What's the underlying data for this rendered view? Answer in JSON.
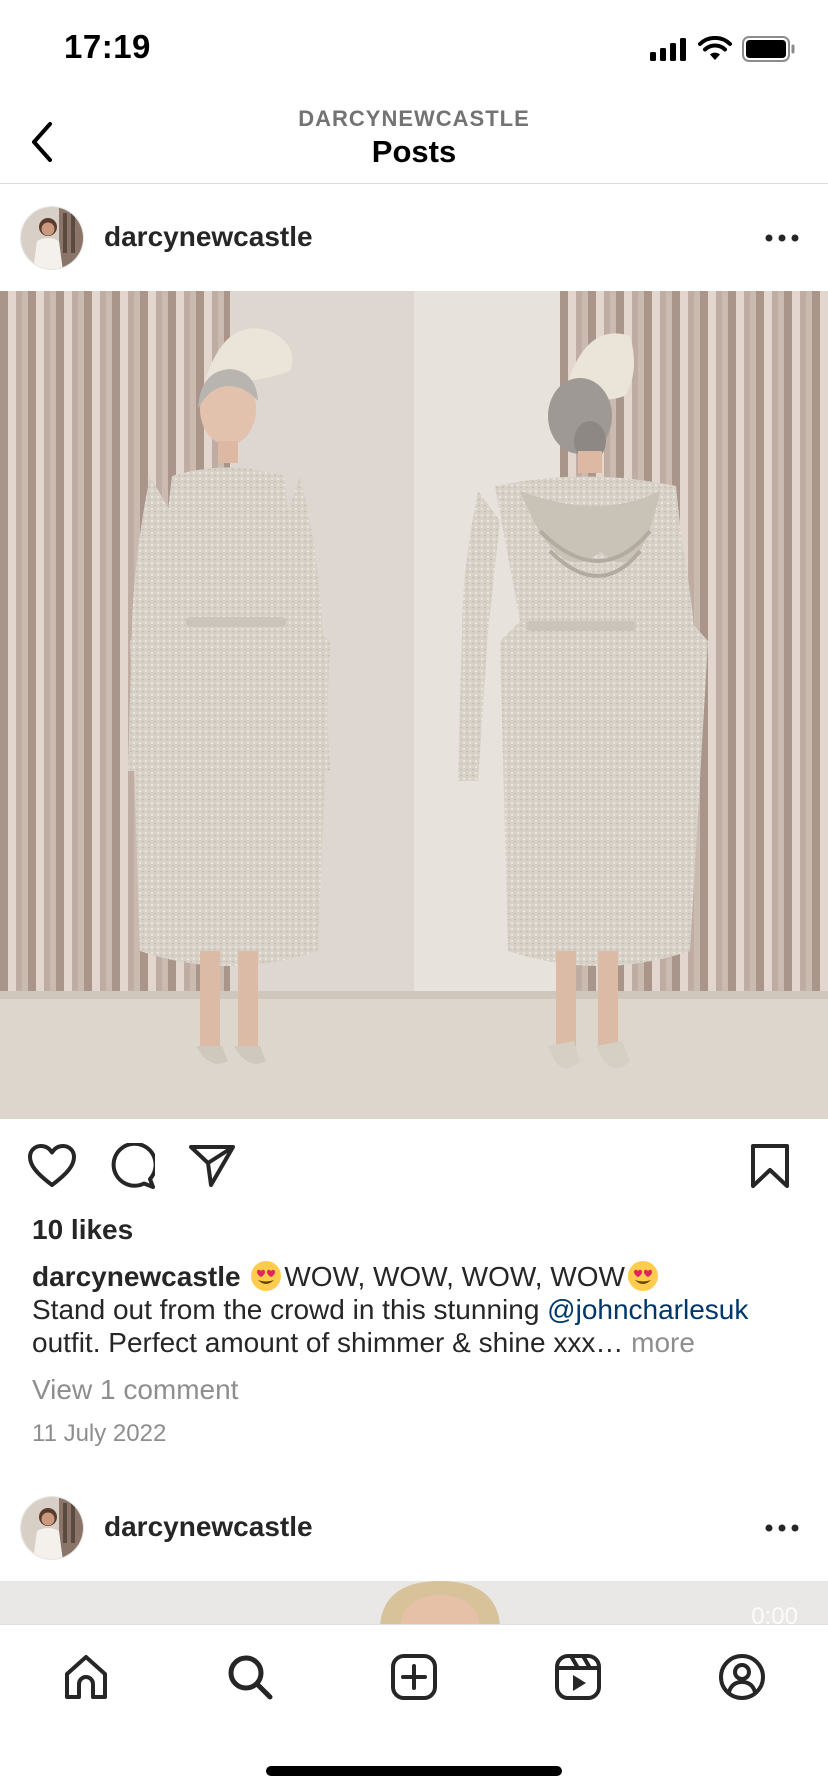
{
  "status_bar": {
    "time": "17:19",
    "icons": [
      "cellular-signal-icon",
      "wifi-icon",
      "battery-icon"
    ]
  },
  "header": {
    "subtitle": "DARCYNEWCASTLE",
    "title": "Posts",
    "back_icon": "chevron-left-icon"
  },
  "post": {
    "username": "darcynewcastle",
    "image_description_icon": "photo",
    "likes": "10 likes",
    "caption": {
      "username": "darcynewcastle",
      "text_part1": "WOW, WOW, WOW, WOW",
      "text_part2": "Stand out from the crowd in this stunning ",
      "mention": "@johncharlesuk",
      "text_part3": "outfit. Perfect amount of shimmer & shine xxx…",
      "more": "more"
    },
    "view_comments": "View 1 comment",
    "date": "11 July 2022"
  },
  "next_post": {
    "username": "darcynewcastle",
    "video_time": "0:00"
  },
  "actions": [
    "heart-icon",
    "comment-icon",
    "share-icon",
    "bookmark-icon"
  ],
  "tab_bar": [
    "home-icon",
    "search-icon",
    "create-icon",
    "reels-icon",
    "profile-icon"
  ],
  "colors": {
    "text": "#262626",
    "secondary": "#8e8e8e",
    "mention": "#00376b",
    "divider": "#dbdbdb"
  }
}
